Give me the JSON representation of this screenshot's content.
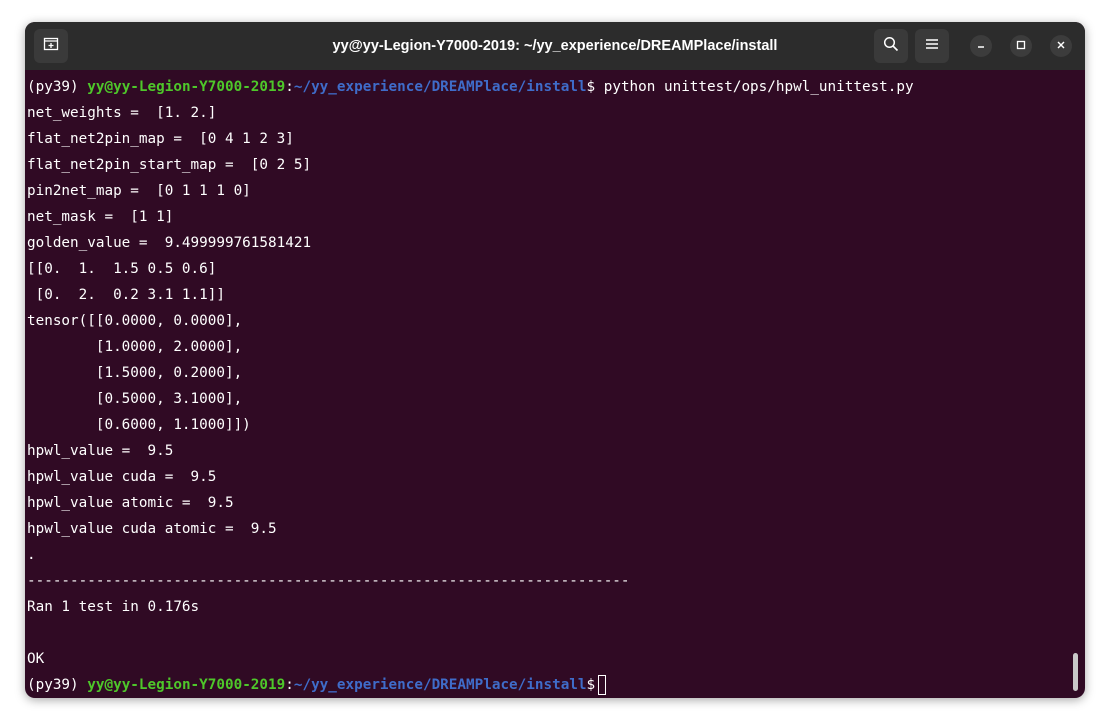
{
  "window": {
    "title": "yy@yy-Legion-Y7000-2019: ~/yy_experience/DREAMPlace/install"
  },
  "titlebar": {
    "icons": [
      "new-tab-icon",
      "search-icon",
      "hamburger-menu-icon",
      "minimize-icon",
      "maximize-icon",
      "close-icon"
    ]
  },
  "colors": {
    "terminal_bg": "#300a24",
    "titlebar_bg": "#2c2c2c",
    "prompt_user": "#4ec72a",
    "prompt_path": "#3f6cc9",
    "text": "#ffffff"
  },
  "prompt": {
    "env": "(py39) ",
    "user_host": "yy@yy-Legion-Y7000-2019",
    "colon": ":",
    "path": "~/yy_experience/DREAMPlace/install",
    "symbol": "$ ",
    "command": "python unittest/ops/hpwl_unittest.py"
  },
  "output": [
    "net_weights =  [1. 2.]",
    "flat_net2pin_map =  [0 4 1 2 3]",
    "flat_net2pin_start_map =  [0 2 5]",
    "pin2net_map =  [0 1 1 1 0]",
    "net_mask =  [1 1]",
    "golden_value =  9.499999761581421",
    "[[0.  1.  1.5 0.5 0.6]",
    " [0.  2.  0.2 3.1 1.1]]",
    "tensor([[0.0000, 0.0000],",
    "        [1.0000, 2.0000],",
    "        [1.5000, 0.2000],",
    "        [0.5000, 3.1000],",
    "        [0.6000, 1.1000]])",
    "hpwl_value =  9.5",
    "hpwl_value cuda =  9.5",
    "hpwl_value atomic =  9.5",
    "hpwl_value cuda atomic =  9.5",
    ".",
    "----------------------------------------------------------------------",
    "Ran 1 test in 0.176s",
    "",
    "OK"
  ]
}
